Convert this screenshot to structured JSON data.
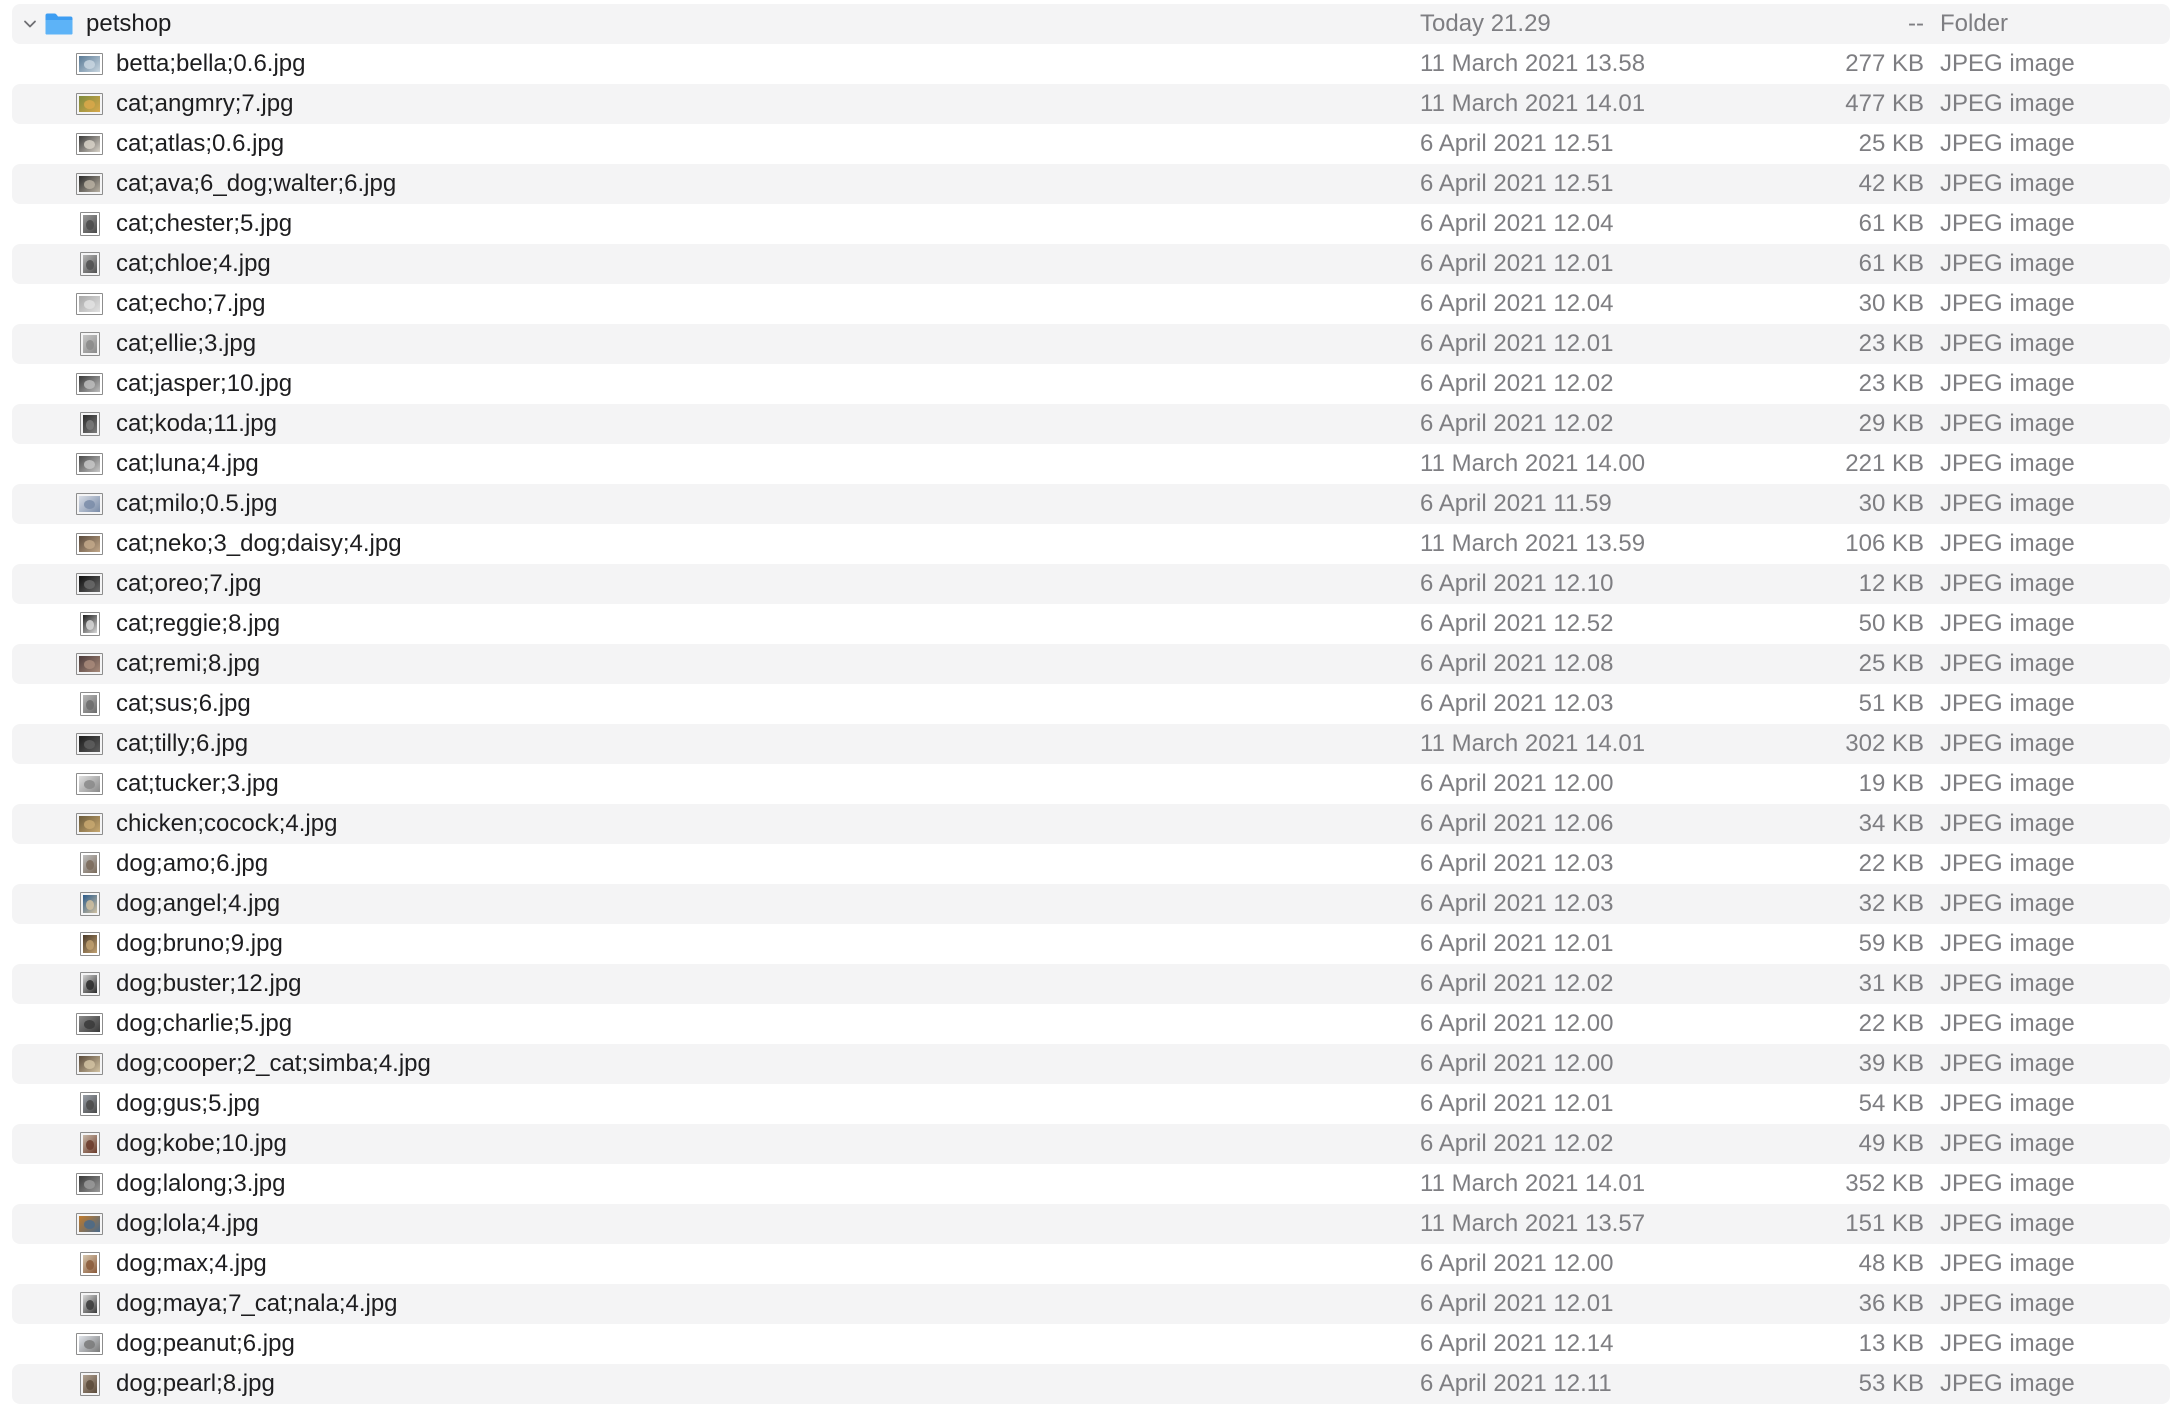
{
  "folder": {
    "name": "petshop",
    "date": "Today 21.29",
    "size": "--",
    "kind": "Folder",
    "icon": "folder-icon",
    "expanded_icon": "chevron-down-icon"
  },
  "files": [
    {
      "name": "betta;bella;0.6.jpg",
      "date": "11 March 2021 13.58",
      "size": "277 KB",
      "kind": "JPEG image",
      "thumb": [
        "#5a7a96",
        "#c9d6e0"
      ],
      "portrait": false
    },
    {
      "name": "cat;angmry;7.jpg",
      "date": "11 March 2021 14.01",
      "size": "477 KB",
      "kind": "JPEG image",
      "thumb": [
        "#7c8a3c",
        "#d9a84a"
      ],
      "portrait": false
    },
    {
      "name": "cat;atlas;0.6.jpg",
      "date": "6 April 2021 12.51",
      "size": "25 KB",
      "kind": "JPEG image",
      "thumb": [
        "#3b3b3b",
        "#d8d2c8"
      ],
      "portrait": false
    },
    {
      "name": "cat;ava;6_dog;walter;6.jpg",
      "date": "6 April 2021 12.51",
      "size": "42 KB",
      "kind": "JPEG image",
      "thumb": [
        "#2a2a2a",
        "#b8b0a2"
      ],
      "portrait": false
    },
    {
      "name": "cat;chester;5.jpg",
      "date": "6 April 2021 12.04",
      "size": "61 KB",
      "kind": "JPEG image",
      "thumb": [
        "#9a9a9a",
        "#4a4a4a"
      ],
      "portrait": true
    },
    {
      "name": "cat;chloe;4.jpg",
      "date": "6 April 2021 12.01",
      "size": "61 KB",
      "kind": "JPEG image",
      "thumb": [
        "#b5b5b5",
        "#505050"
      ],
      "portrait": true
    },
    {
      "name": "cat;echo;7.jpg",
      "date": "6 April 2021 12.04",
      "size": "30 KB",
      "kind": "JPEG image",
      "thumb": [
        "#a8a8a8",
        "#e2e2e2"
      ],
      "portrait": false
    },
    {
      "name": "cat;ellie;3.jpg",
      "date": "6 April 2021 12.01",
      "size": "23 KB",
      "kind": "JPEG image",
      "thumb": [
        "#c6c6c6",
        "#8a8a8a"
      ],
      "portrait": true
    },
    {
      "name": "cat;jasper;10.jpg",
      "date": "6 April 2021 12.02",
      "size": "23 KB",
      "kind": "JPEG image",
      "thumb": [
        "#3a3a3a",
        "#bdbdbd"
      ],
      "portrait": false
    },
    {
      "name": "cat;koda;11.jpg",
      "date": "6 April 2021 12.02",
      "size": "29 KB",
      "kind": "JPEG image",
      "thumb": [
        "#2b2b2b",
        "#7a7a7a"
      ],
      "portrait": true
    },
    {
      "name": "cat;luna;4.jpg",
      "date": "11 March 2021 14.00",
      "size": "221 KB",
      "kind": "JPEG image",
      "thumb": [
        "#4b4b4b",
        "#c7c7c7"
      ],
      "portrait": false
    },
    {
      "name": "cat;milo;0.5.jpg",
      "date": "6 April 2021 11.59",
      "size": "30 KB",
      "kind": "JPEG image",
      "thumb": [
        "#d8dde6",
        "#7a8ca8"
      ],
      "portrait": false
    },
    {
      "name": "cat;neko;3_dog;daisy;4.jpg",
      "date": "11 March 2021 13.59",
      "size": "106 KB",
      "kind": "JPEG image",
      "thumb": [
        "#5a4a3c",
        "#c2a88a"
      ],
      "portrait": false
    },
    {
      "name": "cat;oreo;7.jpg",
      "date": "6 April 2021 12.10",
      "size": "12 KB",
      "kind": "JPEG image",
      "thumb": [
        "#0e0e0e",
        "#6a6a6a"
      ],
      "portrait": false
    },
    {
      "name": "cat;reggie;8.jpg",
      "date": "6 April 2021 12.52",
      "size": "50 KB",
      "kind": "JPEG image",
      "thumb": [
        "#1e1e1e",
        "#d8d8d8"
      ],
      "portrait": true
    },
    {
      "name": "cat;remi;8.jpg",
      "date": "6 April 2021 12.08",
      "size": "25 KB",
      "kind": "JPEG image",
      "thumb": [
        "#4a3a3a",
        "#a88a7a"
      ],
      "portrait": false
    },
    {
      "name": "cat;sus;6.jpg",
      "date": "6 April 2021 12.03",
      "size": "51 KB",
      "kind": "JPEG image",
      "thumb": [
        "#b8b8b8",
        "#6c6c6c"
      ],
      "portrait": true
    },
    {
      "name": "cat;tilly;6.jpg",
      "date": "11 March 2021 14.01",
      "size": "302 KB",
      "kind": "JPEG image",
      "thumb": [
        "#1c1c1c",
        "#5e5e5e"
      ],
      "portrait": false
    },
    {
      "name": "cat;tucker;3.jpg",
      "date": "6 April 2021 12.00",
      "size": "19 KB",
      "kind": "JPEG image",
      "thumb": [
        "#e0e0e0",
        "#8a8a8a"
      ],
      "portrait": false
    },
    {
      "name": "chicken;cocock;4.jpg",
      "date": "6 April 2021 12.06",
      "size": "34 KB",
      "kind": "JPEG image",
      "thumb": [
        "#6a5a3a",
        "#c8a870"
      ],
      "portrait": false
    },
    {
      "name": "dog;amo;6.jpg",
      "date": "6 April 2021 12.03",
      "size": "22 KB",
      "kind": "JPEG image",
      "thumb": [
        "#c0c0c0",
        "#7a6a5a"
      ],
      "portrait": true
    },
    {
      "name": "dog;angel;4.jpg",
      "date": "6 April 2021 12.03",
      "size": "32 KB",
      "kind": "JPEG image",
      "thumb": [
        "#2a5a8a",
        "#d0c0a0"
      ],
      "portrait": true
    },
    {
      "name": "dog;bruno;9.jpg",
      "date": "6 April 2021 12.01",
      "size": "59 KB",
      "kind": "JPEG image",
      "thumb": [
        "#4a3a2a",
        "#c0a070"
      ],
      "portrait": true
    },
    {
      "name": "dog;buster;12.jpg",
      "date": "6 April 2021 12.02",
      "size": "31 KB",
      "kind": "JPEG image",
      "thumb": [
        "#d0d0d0",
        "#2a2a2a"
      ],
      "portrait": true
    },
    {
      "name": "dog;charlie;5.jpg",
      "date": "6 April 2021 12.00",
      "size": "22 KB",
      "kind": "JPEG image",
      "thumb": [
        "#8a8a8a",
        "#3a3a3a"
      ],
      "portrait": false
    },
    {
      "name": "dog;cooper;2_cat;simba;4.jpg",
      "date": "6 April 2021 12.00",
      "size": "39 KB",
      "kind": "JPEG image",
      "thumb": [
        "#5a4a3a",
        "#d2c2a2"
      ],
      "portrait": false
    },
    {
      "name": "dog;gus;5.jpg",
      "date": "6 April 2021 12.01",
      "size": "54 KB",
      "kind": "JPEG image",
      "thumb": [
        "#9aa0a8",
        "#4a4a4a"
      ],
      "portrait": true
    },
    {
      "name": "dog;kobe;10.jpg",
      "date": "6 April 2021 12.02",
      "size": "49 KB",
      "kind": "JPEG image",
      "thumb": [
        "#c8b8a8",
        "#6a3a2a"
      ],
      "portrait": true
    },
    {
      "name": "dog;lalong;3.jpg",
      "date": "11 March 2021 14.01",
      "size": "352 KB",
      "kind": "JPEG image",
      "thumb": [
        "#3a3a3a",
        "#9a9a9a"
      ],
      "portrait": false
    },
    {
      "name": "dog;lola;4.jpg",
      "date": "11 March 2021 13.57",
      "size": "151 KB",
      "kind": "JPEG image",
      "thumb": [
        "#c07a2a",
        "#4a6a8a"
      ],
      "portrait": false
    },
    {
      "name": "dog;max;4.jpg",
      "date": "6 April 2021 12.00",
      "size": "48 KB",
      "kind": "JPEG image",
      "thumb": [
        "#d8c8b0",
        "#8a5a3a"
      ],
      "portrait": true
    },
    {
      "name": "dog;maya;7_cat;nala;4.jpg",
      "date": "6 April 2021 12.01",
      "size": "36 KB",
      "kind": "JPEG image",
      "thumb": [
        "#d8d8d8",
        "#3a3a3a"
      ],
      "portrait": true
    },
    {
      "name": "dog;peanut;6.jpg",
      "date": "6 April 2021 12.14",
      "size": "13 KB",
      "kind": "JPEG image",
      "thumb": [
        "#e0e4ea",
        "#7a7a7a"
      ],
      "portrait": false
    },
    {
      "name": "dog;pearl;8.jpg",
      "date": "6 April 2021 12.11",
      "size": "53 KB",
      "kind": "JPEG image",
      "thumb": [
        "#b0a090",
        "#5a4a3a"
      ],
      "portrait": true
    }
  ]
}
